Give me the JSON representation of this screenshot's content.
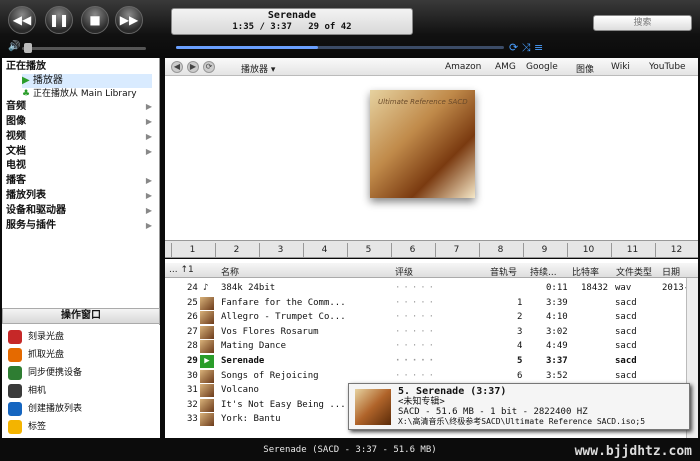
{
  "now_playing": {
    "title": "Serenade",
    "time": "1:35 / 3:37",
    "track": "29 of 42"
  },
  "search": {
    "placeholder": "搜索"
  },
  "sidebar": {
    "now_playing": "正在播放",
    "player": "播放器",
    "from_lib": "正在播放从 Main Library",
    "items": [
      "音频",
      "图像",
      "视频",
      "文档",
      "电视",
      "播客",
      "播放列表",
      "设备和驱动器",
      "服务与插件"
    ],
    "ops_title": "操作窗口",
    "ops": [
      "刻录光盘",
      "抓取光盘",
      "同步便携设备",
      "相机",
      "创建播放列表",
      "标签"
    ],
    "op_colors": [
      "#c62828",
      "#e56a00",
      "#2e7d32",
      "#3a3a3a",
      "#1565c0",
      "#f4b400"
    ]
  },
  "browser": {
    "player_label": "播放器 ▾",
    "links": [
      "Amazon",
      "AMG",
      "Google",
      "图像",
      "Wiki",
      "YouTube"
    ],
    "tabs": [
      "1",
      "2",
      "3",
      "4",
      "5",
      "6",
      "7",
      "8",
      "9",
      "10",
      "11",
      "12"
    ]
  },
  "columns": {
    "name": "名称",
    "rating": "评级",
    "track_no": "音轨号",
    "duration": "持续...",
    "bitrate": "比特率",
    "filetype": "文件类型",
    "date": "日期"
  },
  "rows": [
    {
      "n": "24",
      "name": "384k 24bit",
      "track": "",
      "dur": "0:11",
      "br": "18432",
      "type": "wav",
      "date": "2013-"
    },
    {
      "n": "25",
      "name": "Fanfare for the Comm...",
      "track": "1",
      "dur": "3:39",
      "br": "",
      "type": "sacd",
      "date": ""
    },
    {
      "n": "26",
      "name": "Allegro - Trumpet Co...",
      "track": "2",
      "dur": "4:10",
      "br": "",
      "type": "sacd",
      "date": ""
    },
    {
      "n": "27",
      "name": "Vos Flores Rosarum",
      "track": "3",
      "dur": "3:02",
      "br": "",
      "type": "sacd",
      "date": ""
    },
    {
      "n": "28",
      "name": "Mating Dance",
      "track": "4",
      "dur": "4:49",
      "br": "",
      "type": "sacd",
      "date": ""
    },
    {
      "n": "29",
      "name": "Serenade",
      "track": "5",
      "dur": "3:37",
      "br": "",
      "type": "sacd",
      "date": ""
    },
    {
      "n": "30",
      "name": "Songs of Rejoicing",
      "track": "6",
      "dur": "3:52",
      "br": "",
      "type": "sacd",
      "date": ""
    },
    {
      "n": "31",
      "name": "Volcano",
      "track": "",
      "dur": "",
      "br": "",
      "type": "",
      "date": ""
    },
    {
      "n": "32",
      "name": "It's Not Easy Being ...",
      "track": "",
      "dur": "",
      "br": "",
      "type": "",
      "date": ""
    },
    {
      "n": "33",
      "name": "York: Bantu",
      "track": "",
      "dur": "",
      "br": "",
      "type": "",
      "date": ""
    }
  ],
  "tooltip": {
    "line1": "5. Serenade (3:37)",
    "line2": "<未知专辑>",
    "line3": "SACD - 51.6 MB - 1 bit - 2822400 HZ",
    "line4": "X:\\高清音乐\\终极参考SACD\\Ultimate Reference SACD.iso;5"
  },
  "status": "Serenade (SACD - 3:37 - 51.6 MB)",
  "watermark": "www.bjjdhtz.com",
  "album_text": "Ultimate Reference SACD"
}
